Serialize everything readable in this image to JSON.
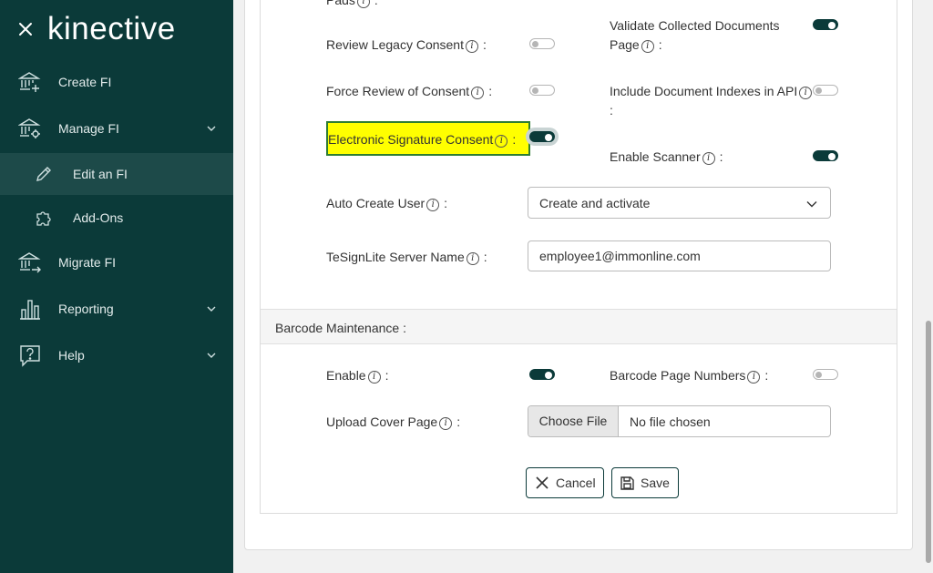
{
  "sidebar": {
    "logo": "kinective",
    "items": [
      {
        "label": "Create FI"
      },
      {
        "label": "Manage FI"
      },
      {
        "label": "Edit an FI"
      },
      {
        "label": "Add-Ons"
      },
      {
        "label": "Migrate FI"
      },
      {
        "label": "Reporting"
      },
      {
        "label": "Help"
      }
    ]
  },
  "form": {
    "top_partial_label": "Pads",
    "review_legacy_consent": {
      "label": "Review Legacy Consent",
      "state": "off"
    },
    "validate_collected_documents": {
      "label_line1": "Validate Collected Documents",
      "label_line2": "Page",
      "state": "on"
    },
    "force_review_consent": {
      "label": "Force Review of Consent",
      "state": "off"
    },
    "include_document_indexes": {
      "label": "Include Document Indexes in API",
      "state": "off"
    },
    "electronic_signature_consent": {
      "label": "Electronic Signature Consent",
      "state": "on"
    },
    "enable_scanner": {
      "label": "Enable Scanner",
      "state": "on"
    },
    "auto_create_user": {
      "label": "Auto Create User",
      "value": "Create and activate"
    },
    "tesignlite_server": {
      "label": "TeSignLite Server Name",
      "value": "employee1@immonline.com"
    },
    "colon": ":",
    "info_glyph": "i"
  },
  "barcode": {
    "section_title": "Barcode Maintenance :",
    "enable": {
      "label": "Enable",
      "state": "on"
    },
    "barcode_page_numbers": {
      "label": "Barcode Page Numbers",
      "state": "off"
    },
    "upload_cover_page": {
      "label": "Upload Cover Page",
      "button": "Choose File",
      "file_name": "No file chosen"
    }
  },
  "actions": {
    "cancel": "Cancel",
    "save": "Save"
  }
}
